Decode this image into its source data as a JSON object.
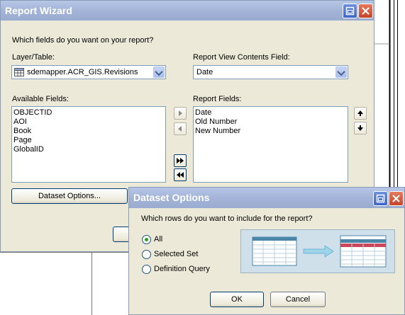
{
  "wizard": {
    "title": "Report Wizard",
    "question": "Which fields do you want on your report?",
    "layer_label": "Layer/Table:",
    "layer_value": "sdemapper.ACR_GIS.Revisions",
    "contents_label": "Report View Contents Field:",
    "contents_value": "Date",
    "available_label": "Available Fields:",
    "available_fields": [
      "OBJECTID",
      "AOI",
      "Book",
      "Page",
      "GlobalID"
    ],
    "report_label": "Report Fields:",
    "report_fields": [
      "Date",
      "Old Number",
      "New Number"
    ],
    "dataset_options_button": "Dataset Options..."
  },
  "dataset": {
    "title": "Dataset Options",
    "question": "Which rows do you want to include for the report?",
    "options": [
      {
        "label": "All",
        "checked": true
      },
      {
        "label": "Selected Set",
        "checked": false
      },
      {
        "label": "Definition Query",
        "checked": false
      }
    ],
    "ok_button": "OK",
    "cancel_button": "Cancel"
  },
  "colors": {
    "dialog_bg": "#ece9d8",
    "titlebar": "#a3b4d8",
    "radio_checked": "#21a121"
  }
}
